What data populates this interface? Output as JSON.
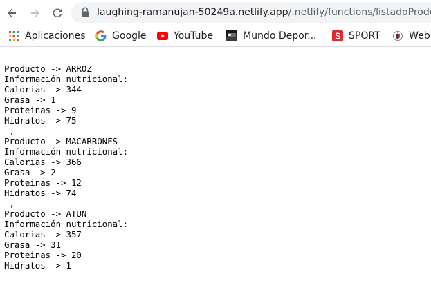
{
  "browser": {
    "url_host": "laughing-ramanujan-50249a.netlify.app",
    "url_path": "/.netlify/functions/listadoProductos"
  },
  "bookmarks": [
    {
      "label": "Aplicaciones",
      "icon": "apps-grid-icon"
    },
    {
      "label": "Google",
      "icon": "google-icon"
    },
    {
      "label": "YouTube",
      "icon": "youtube-icon"
    },
    {
      "label": "Mundo Depor...",
      "icon": "mundo-deportivo-icon"
    },
    {
      "label": "SPORT",
      "icon": "sport-icon"
    },
    {
      "label": "Web",
      "icon": "web-crest-icon"
    }
  ],
  "content": {
    "lines": [
      "Producto -> ARROZ",
      "Información nutricional:",
      "Calorias -> 344",
      "Grasa -> 1",
      "Proteinas -> 9",
      "Hidratos -> 75",
      " ,",
      "Producto -> MACARRONES",
      "Información nutricional:",
      "Calorias -> 366",
      "Grasa -> 2",
      "Proteinas -> 12",
      "Hidratos -> 74",
      " ,",
      "Producto -> ATUN",
      "Información nutricional:",
      "Calorias -> 357",
      "Grasa -> 31",
      "Proteinas -> 20",
      "Hidratos -> 1"
    ]
  },
  "colors": {
    "toolbar_bg": "#ffffff",
    "omnibox_bg": "#f1f3f4",
    "icon_gray": "#5f6368",
    "youtube_red": "#ff0000",
    "sport_red": "#e3262f"
  }
}
